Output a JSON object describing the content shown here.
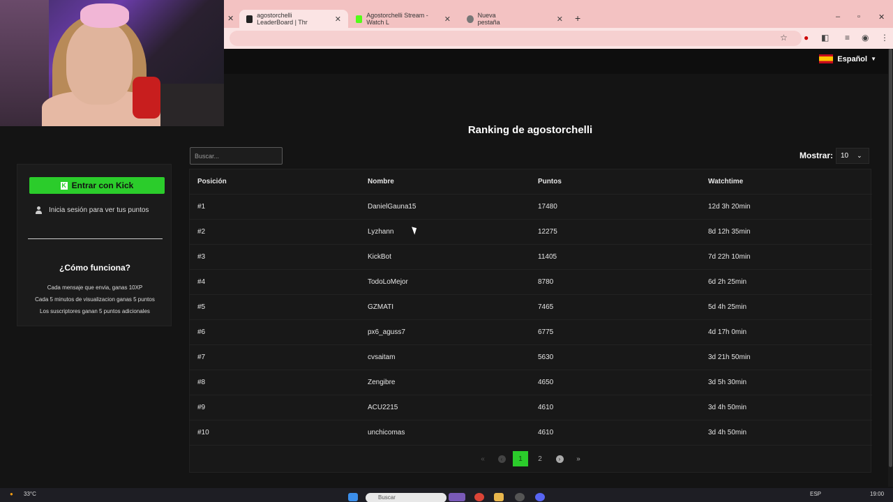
{
  "browser": {
    "tabs": [
      {
        "label": "agostorchelli LeaderBoard | Thr",
        "active": true
      },
      {
        "label": "Agostorchelli Stream - Watch L",
        "active": false
      },
      {
        "label": "Nueva pestaña",
        "active": false
      }
    ],
    "new_tab_icon": "plus-icon"
  },
  "header": {
    "language": "Español"
  },
  "page": {
    "title": "Ranking de agostorchelli"
  },
  "sidebar": {
    "kick_button": "Entrar con Kick",
    "login_hint": "Inicia sesión para ver tus puntos",
    "how_title": "¿Cómo funciona?",
    "how_lines": [
      "Cada mensaje que envia, ganas 10XP",
      "Cada 5 minutos de visualizacion ganas 5 puntos",
      "Los suscriptores ganan 5 puntos adicionales"
    ]
  },
  "controls": {
    "search_placeholder": "Buscar...",
    "show_label": "Mostrar:",
    "show_value": "10"
  },
  "table": {
    "headers": [
      "Posición",
      "Nombre",
      "Puntos",
      "Watchtime"
    ],
    "rows": [
      [
        "#1",
        "DanielGauna15",
        "17480",
        "12d 3h 20min"
      ],
      [
        "#2",
        "Lyzhann",
        "12275",
        "8d 12h 35min"
      ],
      [
        "#3",
        "KickBot",
        "11405",
        "7d 22h 10min"
      ],
      [
        "#4",
        "TodoLoMejor",
        "8780",
        "6d 2h 25min"
      ],
      [
        "#5",
        "GZMATI",
        "7465",
        "5d 4h 25min"
      ],
      [
        "#6",
        "px6_aguss7",
        "6775",
        "4d 17h 0min"
      ],
      [
        "#7",
        "cvsaitam",
        "5630",
        "3d 21h 50min"
      ],
      [
        "#8",
        "Zengibre",
        "4650",
        "3d 5h 30min"
      ],
      [
        "#9",
        "ACU2215",
        "4610",
        "3d 4h 50min"
      ],
      [
        "#10",
        "unchicomas",
        "4610",
        "3d 4h 50min"
      ]
    ]
  },
  "pagination": {
    "first": "«",
    "prev": "‹",
    "pages": [
      "1",
      "2"
    ],
    "current": "1",
    "next": "›",
    "last": "»"
  },
  "taskbar": {
    "weather": "33°C",
    "search": "Buscar",
    "lang": "ESP",
    "time": "19:00"
  }
}
